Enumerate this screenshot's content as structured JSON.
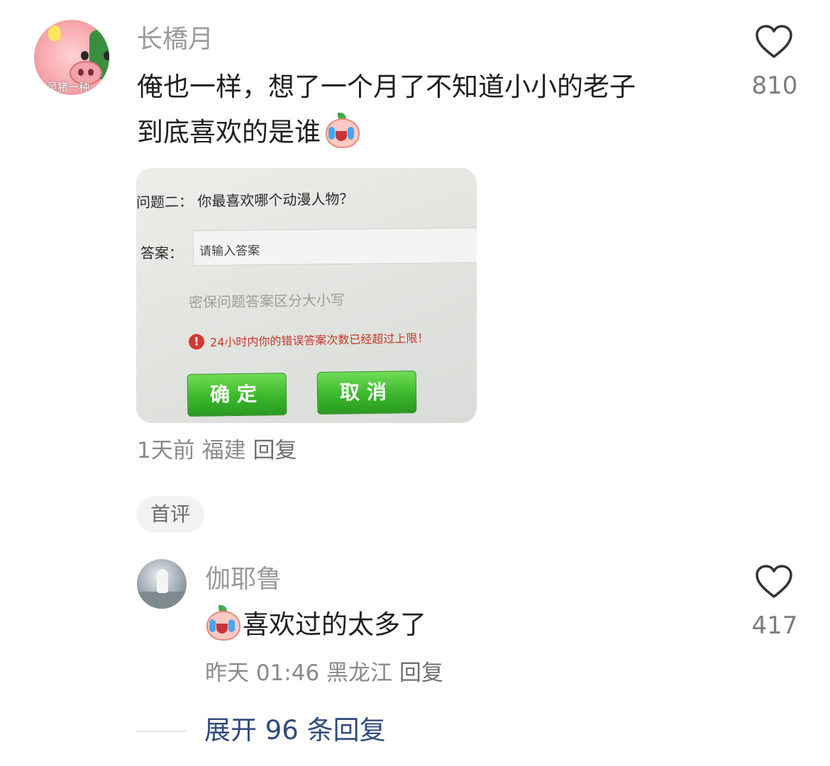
{
  "comments": [
    {
      "username": "长橋月",
      "avatar_caption": "灵猪一种",
      "text_line1": "俺也一样，想了一个月了不知道小小的老子",
      "text_line2": "到底喜欢的是谁",
      "emoji": "crying-face-emoji",
      "likes": "810",
      "time": "1天前",
      "location": "福建",
      "reply_label": "回复",
      "badge": "首评",
      "image": {
        "question": "问题二：  你最喜欢哪个动漫人物？",
        "answer_label": "答案：",
        "answer_placeholder": "请输入答案",
        "hint": "密保问题答案区分大小写",
        "error_icon": "!",
        "error": "24小时内你的错误答案次数已经超过上限！",
        "confirm_label": "确定",
        "cancel_label": "取消"
      }
    },
    {
      "username": "伽耶鲁",
      "text": "喜欢过的太多了",
      "emoji": "crying-face-emoji",
      "likes": "417",
      "time": "昨天 01:46",
      "location": "黑龙江",
      "reply_label": "回复"
    }
  ],
  "expand_replies": "展开 96 条回复",
  "colors": {
    "link": "#2f4a7e",
    "meta": "#8a8a8a",
    "button_green": "#3bb82c",
    "error_red": "#c8352b"
  }
}
